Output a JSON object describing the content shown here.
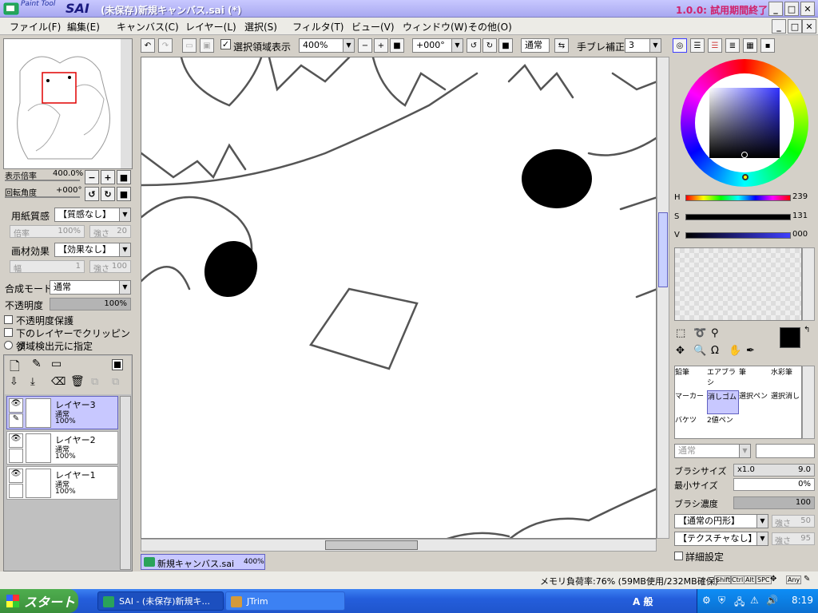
{
  "titlebar": {
    "brand_small": "Paint Tool",
    "brand_big": "SAI",
    "document": "(未保存)新規キャンバス.sai (*)",
    "trial": "1.0.0: 試用期間終了"
  },
  "menu": [
    "ファイル(F)",
    "編集(E)",
    "キャンバス(C)",
    "レイヤー(L)",
    "選択(S)",
    "フィルタ(T)",
    "ビュー(V)",
    "ウィンドウ(W)",
    "その他(O)"
  ],
  "toolbar": {
    "show_selection_label": "選択領域表示",
    "zoom": "400%",
    "rotation": "+000°",
    "blend": "通常",
    "stabilizer_label": "手ブレ補正",
    "stabilizer_value": "3"
  },
  "navigator": {
    "zoom_label": "表示倍率",
    "zoom_value": "400.0%",
    "angle_label": "回転角度",
    "angle_value": "+000°"
  },
  "paper": {
    "texture_label": "用紙質感",
    "texture_value": "【質感なし】",
    "scale_label": "倍率",
    "scale_value": "100%",
    "strength_label": "強さ",
    "strength_value": "20",
    "effect_label": "画材効果",
    "effect_value": "【効果なし】",
    "width_label": "幅",
    "width_value": "1",
    "effect_strength_value": "100"
  },
  "layer_props": {
    "blend_label": "合成モード",
    "blend_value": "通常",
    "opacity_label": "不透明度",
    "opacity_value": "100%",
    "opacity_fraction": 1.0,
    "preserve_opacity": "不透明度保護",
    "clip_lower": "下のレイヤーでクリッピング",
    "selection_source": "領域検出元に指定"
  },
  "layers": [
    {
      "name": "レイヤー3",
      "mode": "通常",
      "opacity": "100%",
      "selected": true
    },
    {
      "name": "レイヤー2",
      "mode": "通常",
      "opacity": "100%",
      "selected": false
    },
    {
      "name": "レイヤー1",
      "mode": "通常",
      "opacity": "100%",
      "selected": false
    }
  ],
  "canvas_tab": {
    "name": "新規キャンバス.sai",
    "zoom": "400%"
  },
  "color": {
    "h_label": "H",
    "h_value": "239",
    "s_label": "S",
    "s_value": "131",
    "v_label": "V",
    "v_value": "000",
    "h_fraction": 0.66,
    "s_fraction": 0.51,
    "v_fraction": 0.0
  },
  "tools": [
    {
      "name": "鉛筆"
    },
    {
      "name": "エアブラシ"
    },
    {
      "name": "筆"
    },
    {
      "name": "水彩筆"
    },
    {
      "name": "マーカー"
    },
    {
      "name": "消しゴム"
    },
    {
      "name": "選択ペン"
    },
    {
      "name": "選択消し"
    },
    {
      "name": "バケツ"
    },
    {
      "name": "2値ペン"
    }
  ],
  "brush": {
    "mode": "通常",
    "size_label": "ブラシサイズ",
    "size_mult": "x1.0",
    "size_value": "9.0",
    "min_size_label": "最小サイズ",
    "min_size_value": "0%",
    "density_label": "ブラシ濃度",
    "density_value": "100",
    "shape": "【通常の円形】",
    "shape_strength_label": "強さ",
    "shape_strength_value": "50",
    "texture": "【テクスチャなし】",
    "texture_strength_label": "強さ",
    "texture_strength_value": "95",
    "details_label": "詳細設定"
  },
  "status": {
    "memory": "メモリ負荷率:76% (59MB使用/232MB確保)",
    "keys": [
      "Shift",
      "Ctrl",
      "Alt",
      "SPC",
      "Any"
    ]
  },
  "taskbar": {
    "start": "スタート",
    "tasks": [
      "SAI - (未保存)新規キ...",
      "JTrim"
    ],
    "ime": "A 般",
    "time": "8:19"
  }
}
